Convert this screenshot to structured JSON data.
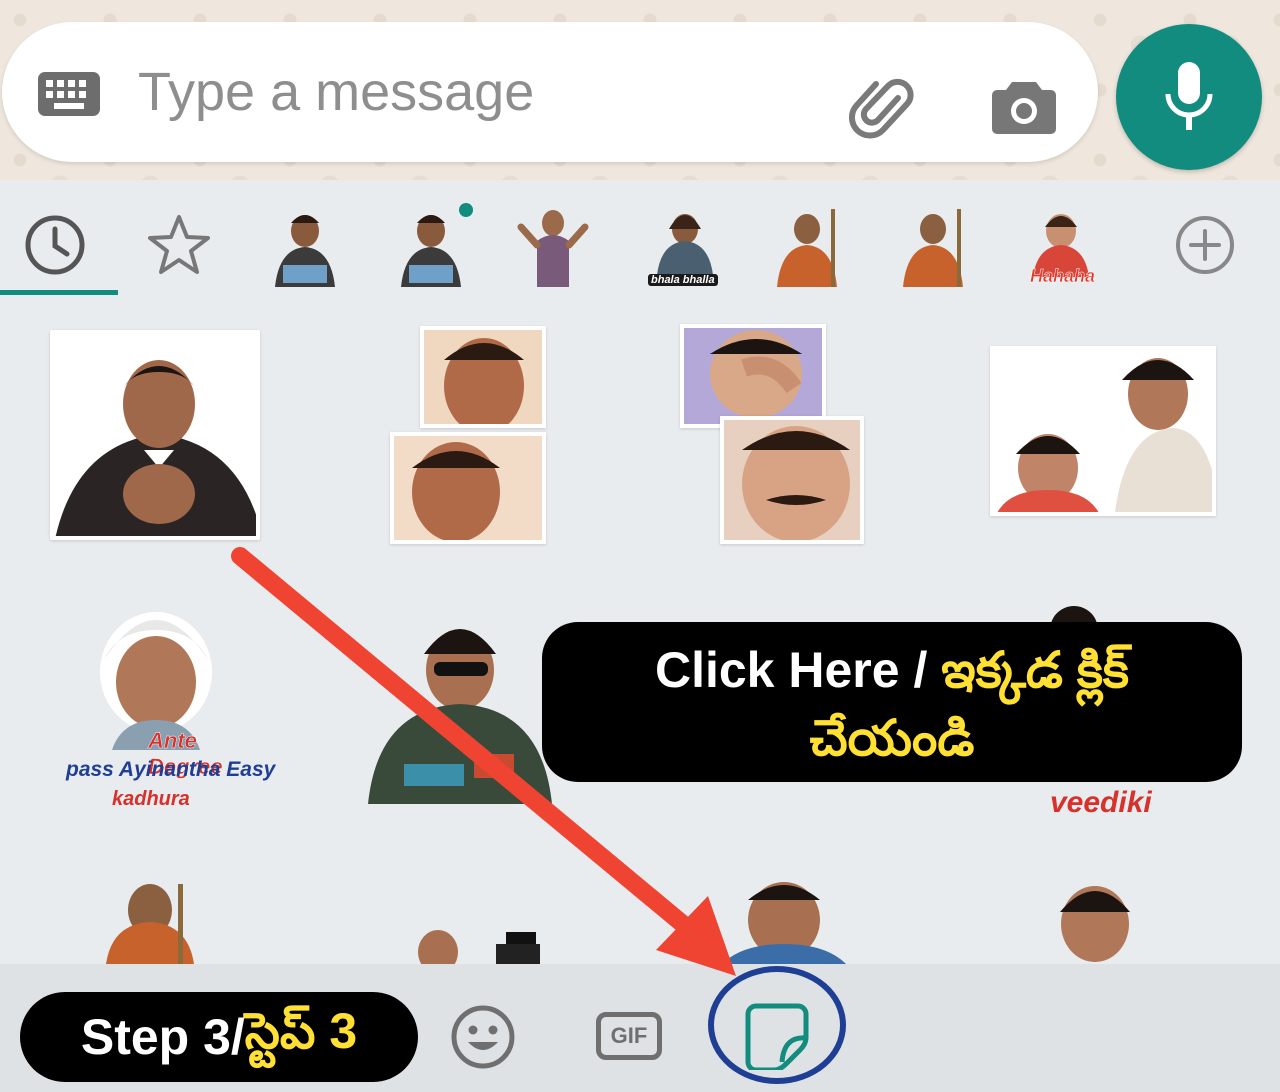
{
  "composer": {
    "placeholder": "Type a message"
  },
  "icons": {
    "keyboard": "keyboard-icon",
    "attach": "paperclip-icon",
    "camera": "camera-icon",
    "mic": "mic-icon",
    "recent": "clock-icon",
    "favorites": "star-icon",
    "add_pack": "plus-icon",
    "emoji": "smiley-icon",
    "gif": "gif-icon",
    "sticker": "sticker-icon"
  },
  "sticker_tabs": {
    "pack_labels": [
      "bhala bhalla",
      "Hahaha"
    ]
  },
  "stickers": {
    "row2_left_caption": [
      "Ante Degree",
      "pass Ayinantha Easy",
      "kadhura"
    ],
    "row2_right_caption": "veediki"
  },
  "bottom": {
    "gif_label": "GIF"
  },
  "annotations": {
    "step_prefix": "Step 3/",
    "step_telugu": "స్టెప్ 3",
    "callout_en": "Click Here / ",
    "callout_te1": "ఇక్కడ క్లిక్",
    "callout_te2": "చేయండి"
  },
  "colors": {
    "accent": "#128c7e",
    "arrow": "#f04433",
    "highlight_ring": "#1f3f94",
    "annotation_yellow": "#ffe033"
  }
}
